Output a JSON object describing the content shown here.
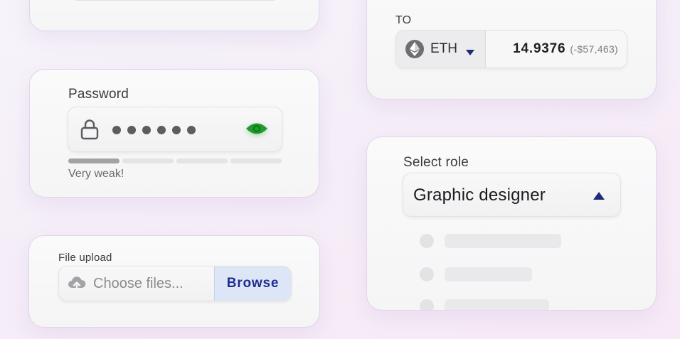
{
  "password": {
    "label": "Password",
    "masked_length": 6,
    "strength_hint": "Very weak!",
    "strength_level": "1/4"
  },
  "upload": {
    "label": "File upload",
    "placeholder": "Choose files...",
    "browse_label": "Browse"
  },
  "exchange": {
    "to_label": "TO",
    "token": "ETH",
    "amount": "14.9376",
    "amount_usd": "(-$57,463)"
  },
  "role": {
    "label": "Select role",
    "selected": "Graphic designer",
    "dropdown_open": true
  },
  "icons": {
    "lock": "lock-icon",
    "eye": "eye-icon",
    "cloud": "cloud-upload-icon",
    "eth": "ethereum-icon",
    "caret_down": "caret-down-icon",
    "caret_up": "caret-up-icon"
  },
  "colors": {
    "eye_green": "#1f9b2a",
    "browse_text": "#1f2e8f",
    "browse_bg": "#dce6f6",
    "caret_navy": "#1f2a78",
    "card_border": "#e2d3ea"
  }
}
